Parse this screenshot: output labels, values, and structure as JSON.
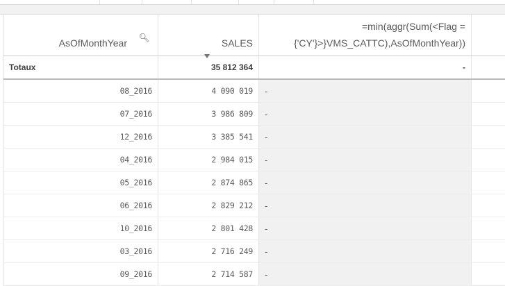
{
  "table": {
    "headers": [
      "AsOfMonthYear",
      "SALES",
      "=min(aggr(Sum(<Flag = {'CY'}>}VMS_CATTC),AsOfMonthYear))"
    ],
    "totals": {
      "label": "Totaux",
      "sales": "35 812 364",
      "expr": "-"
    },
    "rows": [
      {
        "month": "08_2016",
        "sales": "4 090 019",
        "expr": "-"
      },
      {
        "month": "07_2016",
        "sales": "3 986 809",
        "expr": "-"
      },
      {
        "month": "12_2016",
        "sales": "3 385 541",
        "expr": "-"
      },
      {
        "month": "04_2016",
        "sales": "2 984 015",
        "expr": "-"
      },
      {
        "month": "05_2016",
        "sales": "2 874 865",
        "expr": "-"
      },
      {
        "month": "06_2016",
        "sales": "2 829 212",
        "expr": "-"
      },
      {
        "month": "10_2016",
        "sales": "2 801 428",
        "expr": "-"
      },
      {
        "month": "03_2016",
        "sales": "2 716 249",
        "expr": "-"
      },
      {
        "month": "09_2016",
        "sales": "2 714 587",
        "expr": "-"
      }
    ]
  }
}
